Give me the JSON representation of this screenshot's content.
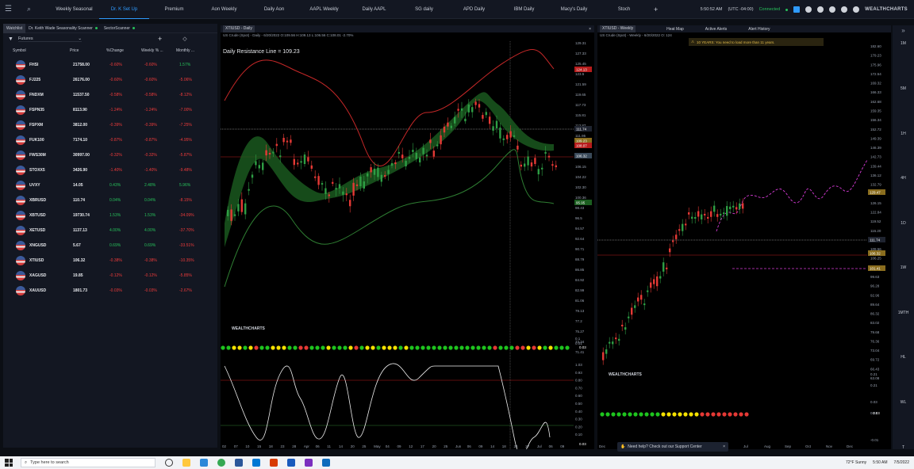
{
  "topbar": {
    "tabs": [
      {
        "label": "Weekly Seasonal",
        "active": false
      },
      {
        "label": "Dr. K Set Up",
        "active": true
      },
      {
        "label": "Premium",
        "active": false
      },
      {
        "label": "Aon Weekly",
        "active": false
      },
      {
        "label": "Daily Aon",
        "active": false
      },
      {
        "label": "AAPL Weekly",
        "active": false
      },
      {
        "label": "Daily AAPL",
        "active": false
      },
      {
        "label": "SG daily",
        "active": false
      },
      {
        "label": "APD Daily",
        "active": false
      },
      {
        "label": "IBM Daily",
        "active": false
      },
      {
        "label": "Macy's Daily",
        "active": false
      },
      {
        "label": "Stoch",
        "active": false
      }
    ],
    "add_tab": "+",
    "time": "5:50:52 AM",
    "timezone": "(UTC -04:00)",
    "status": "Connected",
    "brand": "WEALTHCHARTS"
  },
  "watchlist": {
    "tabs": [
      {
        "label": "Watchlist",
        "active": true
      },
      {
        "label": "Dr. Keith Wade Seasonality Scanner",
        "active": false
      },
      {
        "label": "SectorScanner",
        "active": false
      }
    ],
    "list_name": "Futures",
    "headers": [
      "Symbol",
      "Price",
      "%Change",
      "Weekly % ...",
      "Monthly ..."
    ],
    "rows": [
      {
        "sym": "FHSI",
        "price": "21758.00",
        "chg": "-0.60%",
        "wk": "-0.60%",
        "mo": "1.57%",
        "chg_pos": false,
        "mo_pos": true
      },
      {
        "sym": "FJ225",
        "price": "26176.00",
        "chg": "-0.60%",
        "wk": "-0.60%",
        "mo": "-5.06%",
        "chg_pos": false,
        "mo_pos": false
      },
      {
        "sym": "FNDXM",
        "price": "11537.50",
        "chg": "-0.58%",
        "wk": "-0.58%",
        "mo": "-8.12%",
        "chg_pos": false,
        "mo_pos": false
      },
      {
        "sym": "FSPN35",
        "price": "8113.90",
        "chg": "-1.24%",
        "wk": "-1.24%",
        "mo": "-7.00%",
        "chg_pos": false,
        "mo_pos": false
      },
      {
        "sym": "FSPXM",
        "price": "3812.00",
        "chg": "-0.39%",
        "wk": "-0.39%",
        "mo": "-7.25%",
        "chg_pos": false,
        "mo_pos": false
      },
      {
        "sym": "FUK100",
        "price": "7174.10",
        "chg": "-0.87%",
        "wk": "-0.87%",
        "mo": "-4.95%",
        "chg_pos": false,
        "mo_pos": false
      },
      {
        "sym": "FWS30M",
        "price": "30997.00",
        "chg": "-0.32%",
        "wk": "-0.32%",
        "mo": "-5.87%",
        "chg_pos": false,
        "mo_pos": false
      },
      {
        "sym": "STOXX5",
        "price": "3426.90",
        "chg": "-1.40%",
        "wk": "-1.40%",
        "mo": "-9.48%",
        "chg_pos": false,
        "mo_pos": false
      },
      {
        "sym": "UVXY",
        "price": "14.05",
        "chg": "0.43%",
        "wk": "2.48%",
        "mo": "5.96%",
        "chg_pos": true,
        "mo_pos": true
      },
      {
        "sym": "XBRUSD",
        "price": "110.74",
        "chg": "0.04%",
        "wk": "0.04%",
        "mo": "-8.15%",
        "chg_pos": true,
        "mo_pos": false
      },
      {
        "sym": "XBTUSD",
        "price": "19730.74",
        "chg": "1.53%",
        "wk": "1.53%",
        "mo": "-34.09%",
        "chg_pos": true,
        "mo_pos": false
      },
      {
        "sym": "XETUSD",
        "price": "1137.13",
        "chg": "4.00%",
        "wk": "4.00%",
        "mo": "-37.70%",
        "chg_pos": true,
        "mo_pos": false
      },
      {
        "sym": "XNGUSD",
        "price": "5.67",
        "chg": "0.69%",
        "wk": "0.69%",
        "mo": "-33.51%",
        "chg_pos": true,
        "mo_pos": false
      },
      {
        "sym": "XTIUSD",
        "price": "106.32",
        "chg": "-0.38%",
        "wk": "-0.38%",
        "mo": "-10.35%",
        "chg_pos": false,
        "mo_pos": false
      },
      {
        "sym": "XAGUSD",
        "price": "19.85",
        "chg": "-0.12%",
        "wk": "-0.12%",
        "mo": "-5.85%",
        "chg_pos": false,
        "mo_pos": false
      },
      {
        "sym": "XAUUSD",
        "price": "1801.73",
        "chg": "-0.03%",
        "wk": "-0.03%",
        "mo": "-2.67%",
        "chg_pos": false,
        "mo_pos": false
      }
    ]
  },
  "daily_chart": {
    "tab": "XTIUSD - Daily",
    "subtitle": "US Crude (Spot) - Daily - 6/20/2022 O:109.56 H:109.13 L:106.56 C:108.01 -2.70%",
    "annotation": "Daily Resistance Line = 109.23",
    "y_ticks": [
      "129.31",
      "127.33",
      "125.45",
      "123.5",
      "121.59",
      "119.65",
      "117.73",
      "115.81",
      "113.87",
      "111.95",
      "110.12",
      "108.07",
      "106.15",
      "104.22",
      "102.30",
      "100.36",
      "98.43",
      "96.5",
      "94.57",
      "92.64",
      "90.71",
      "88.79",
      "86.85",
      "84.92",
      "82.99",
      "81.06",
      "79.13",
      "77.2",
      "75.27",
      "73.34",
      "71.41"
    ],
    "price_tags": [
      {
        "label": "124.13",
        "color": "#b71c1c"
      },
      {
        "label": "111.74",
        "color": "#1f2430"
      },
      {
        "label": "109.23",
        "color": "#8a6d1e"
      },
      {
        "label": "108.07",
        "color": "#b71c1c"
      },
      {
        "label": "106.32",
        "color": "#3a4a5a"
      },
      {
        "label": "95.95",
        "color": "#1b5e20"
      }
    ],
    "x_labels": [
      "02",
      "07",
      "10",
      "15",
      "18",
      "23",
      "28",
      "Apr",
      "06",
      "11",
      "14",
      "20",
      "25",
      "May",
      "04",
      "09",
      "12",
      "17",
      "20",
      "25",
      "Jun",
      "06",
      "09",
      "14",
      "18",
      "23",
      "27",
      "Jul",
      "06",
      "09"
    ],
    "indicator_ticks": [
      "0.1",
      "0.01"
    ],
    "indicator_value": "0.03",
    "stoch_ticks": [
      "1.03",
      "0.93",
      "0.80",
      "0.70",
      "0.60",
      "0.50",
      "0.40",
      "0.30",
      "0.20",
      "0.10"
    ],
    "stoch_value": "0.03",
    "logo": "WEALTHCHARTS",
    "cursor_date": "6/20/2022"
  },
  "weekly_chart": {
    "tab": "XTIUSD - Weekly",
    "other_tabs": [
      {
        "label": "Heat Map"
      },
      {
        "label": "Active Alerts"
      },
      {
        "label": "Alert History"
      }
    ],
    "subtitle": "US Crude (Spot) - Weekly - 6/20/2022 O: 124",
    "alert": "10 YEARS: You need to load more than 11 years.",
    "y_ticks": [
      "182.60",
      "179.23",
      "175.96",
      "172.54",
      "169.32",
      "166.33",
      "162.68",
      "159.35",
      "156.34",
      "152.72",
      "149.39",
      "146.39",
      "142.73",
      "139.44",
      "136.12",
      "132.79",
      "129.47",
      "126.15",
      "122.84",
      "119.52",
      "116.20",
      "112.88",
      "109.56",
      "106.25",
      "102.93",
      "99.63",
      "96.28",
      "92.96",
      "89.64",
      "86.32",
      "83.02",
      "79.68",
      "76.36",
      "73.04",
      "69.72",
      "66.43",
      "63.08"
    ],
    "price_tags": [
      {
        "label": "129.47",
        "color": "#8a6d1e"
      },
      {
        "label": "111.74",
        "color": "#1f2430"
      },
      {
        "label": "106.32",
        "color": "#8a6d1e"
      },
      {
        "label": "101.41",
        "color": "#8a6d1e"
      }
    ],
    "x_labels": [
      "Dec",
      "Jan",
      "Feb",
      "Mar",
      "Apr",
      "May",
      "Jun",
      "Jul",
      "Aug",
      "Sep",
      "Oct",
      "Nov",
      "Dec"
    ],
    "indicator_ticks": [
      "0.21",
      "0.21",
      "0.03",
      "0.21",
      "-0.01"
    ],
    "indicator_value": "0.03",
    "logo": "WEALTHCHARTS",
    "help_text": "Need help? Check out our Support Center"
  },
  "timeframes": [
    "1M",
    "5M",
    "1H",
    "4H",
    "1D",
    "1W",
    "1MTH",
    "HL",
    "WL",
    "T"
  ],
  "colors": {
    "accent": "#2f9bff",
    "up": "#27c15b",
    "down": "#ef3b3b",
    "panel": "#131722"
  },
  "taskbar": {
    "search_placeholder": "Type here to search",
    "weather": "72°F Sunny",
    "time": "5:50 AM",
    "date": "7/5/2022"
  }
}
